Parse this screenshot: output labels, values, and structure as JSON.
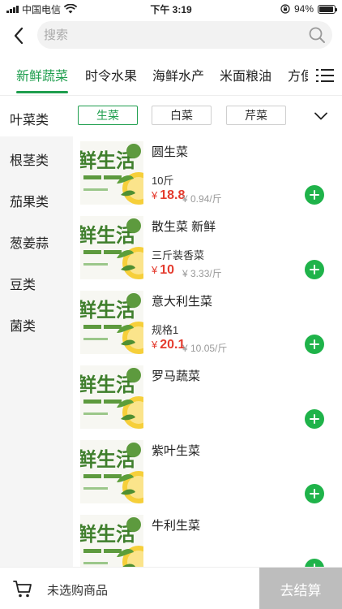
{
  "status_bar": {
    "carrier": "中国电信",
    "time": "下午 3:19",
    "battery": "94%",
    "battery_level": 0.94
  },
  "search": {
    "placeholder": "搜索"
  },
  "tabs": [
    {
      "label": "新鲜蔬菜",
      "active": true
    },
    {
      "label": "时令水果",
      "active": false
    },
    {
      "label": "海鲜水产",
      "active": false
    },
    {
      "label": "米面粮油",
      "active": false
    },
    {
      "label": "方便",
      "active": false
    }
  ],
  "subcategory": {
    "label": "叶菜类",
    "chips": [
      {
        "label": "生菜",
        "active": true
      },
      {
        "label": "白菜",
        "active": false
      },
      {
        "label": "芹菜",
        "active": false
      },
      {
        "label": "",
        "active": false
      }
    ]
  },
  "sidebar": [
    "根茎类",
    "茄果类",
    "葱姜蒜",
    "豆类",
    "菌类"
  ],
  "products": [
    {
      "name": "圆生菜",
      "spec": "10斤",
      "currency": "¥",
      "price": "18.8",
      "unit_price": "¥ 0.94/斤"
    },
    {
      "name": "散生菜 新鲜",
      "spec": "三斤装香菜",
      "currency": "¥",
      "price": "10",
      "unit_price": "¥ 3.33/斤"
    },
    {
      "name": "意大利生菜",
      "spec": "规格1",
      "currency": "¥",
      "price": "20.1",
      "unit_price": "¥ 10.05/斤"
    },
    {
      "name": "罗马蔬菜",
      "spec": "",
      "currency": "",
      "price": "",
      "unit_price": ""
    },
    {
      "name": "紫叶生菜",
      "spec": "",
      "currency": "",
      "price": "",
      "unit_price": ""
    },
    {
      "name": "牛利生菜",
      "spec": "",
      "currency": "",
      "price": "",
      "unit_price": ""
    }
  ],
  "thumb_text": {
    "logo": "鲜生活"
  },
  "bottom_bar": {
    "cart_text": "未选购商品",
    "checkout_label": "去结算"
  },
  "colors": {
    "accent": "#1f9e4e",
    "price": "#e43b2e",
    "add_button": "#1fb34a",
    "checkout_disabled": "#bdbdbd"
  },
  "icons": {
    "back": "chevron-left-icon",
    "search": "search-icon",
    "menu": "menu-icon",
    "expand": "chevron-down-icon",
    "add": "plus-icon",
    "cart": "cart-icon",
    "wifi": "wifi-icon",
    "lock": "rotation-lock-icon"
  }
}
